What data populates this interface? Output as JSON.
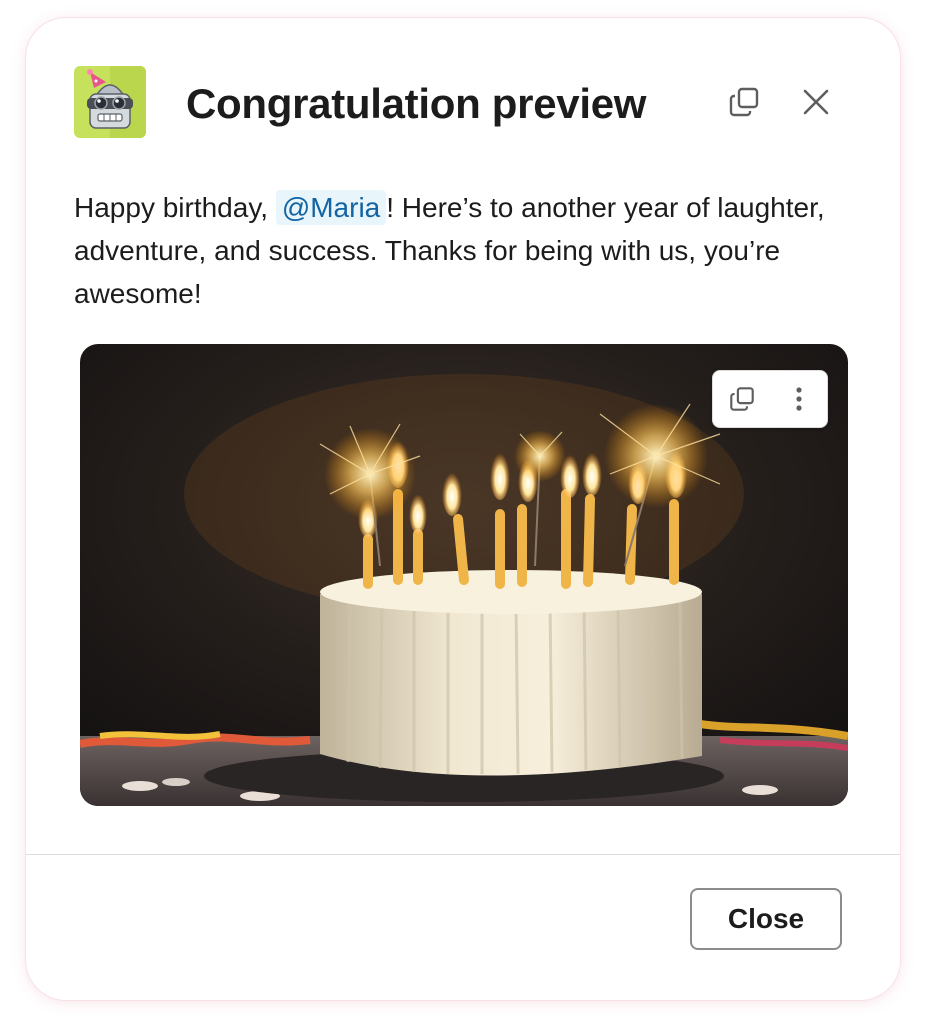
{
  "dialog": {
    "title": "Congratulation preview",
    "app_icon": "robot-party-hat-icon",
    "header_actions": [
      {
        "name": "copy",
        "icon": "copy-icon"
      },
      {
        "name": "close",
        "icon": "close-icon"
      }
    ]
  },
  "message": {
    "prefix": "Happy birthday, ",
    "mention": "@Maria",
    "suffix": "! Here’s to another year of laughter, adventure, and success. Thanks for being with us, you’re awesome!"
  },
  "image": {
    "subject": "birthday cake with lit candles and sparklers",
    "toolbar": [
      {
        "name": "copy",
        "icon": "copy-icon"
      },
      {
        "name": "more",
        "icon": "more-vertical-icon"
      }
    ]
  },
  "footer": {
    "close_label": "Close"
  },
  "colors": {
    "mention_bg": "#e8f5fa",
    "mention_text": "#1264a3",
    "title_text": "#1d1c1d",
    "app_icon_bg": "#c6e15c"
  }
}
